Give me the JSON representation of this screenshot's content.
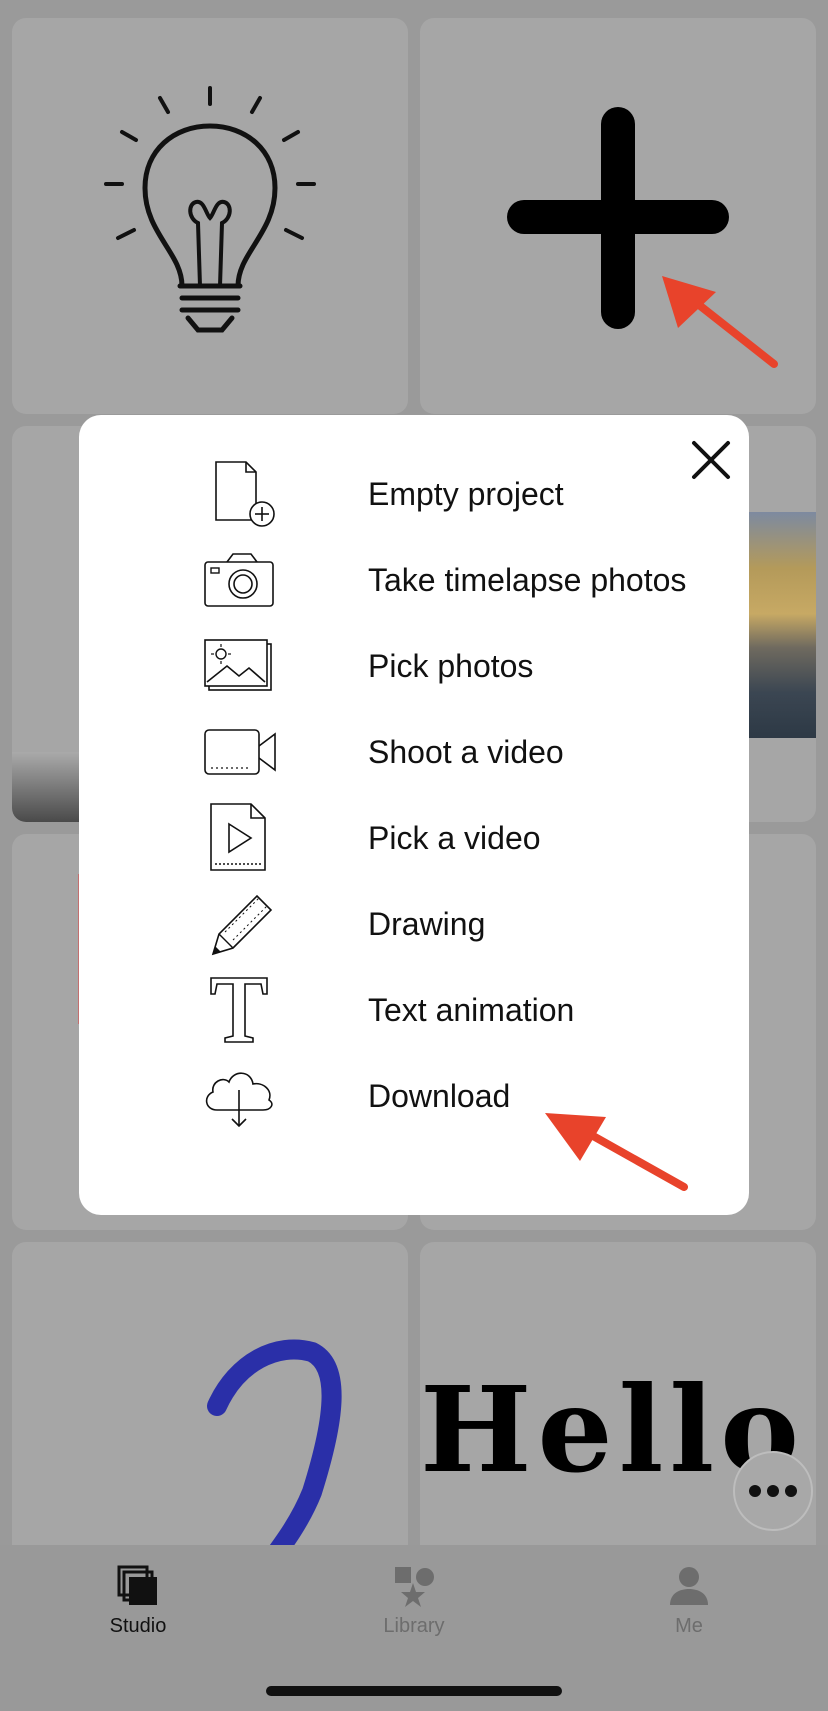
{
  "modal": {
    "items": [
      {
        "label": "Empty project",
        "icon": "new-document-icon"
      },
      {
        "label": "Take timelapse photos",
        "icon": "camera-icon"
      },
      {
        "label": "Pick photos",
        "icon": "photos-icon"
      },
      {
        "label": "Shoot a video",
        "icon": "video-camera-icon"
      },
      {
        "label": "Pick a video",
        "icon": "video-file-icon"
      },
      {
        "label": "Drawing",
        "icon": "pencil-icon"
      },
      {
        "label": "Text animation",
        "icon": "text-icon"
      },
      {
        "label": "Download",
        "icon": "cloud-download-icon"
      }
    ],
    "close_icon": "close-icon"
  },
  "grid": {
    "tiles": [
      {
        "icon": "lightbulb-icon"
      },
      {
        "icon": "plus-icon"
      },
      {
        "preview": "gradient"
      },
      {
        "preview": "photo"
      },
      {
        "preview": "blank"
      },
      {
        "preview": "blank"
      },
      {
        "preview": "drawing"
      },
      {
        "preview_text": "Hello"
      }
    ]
  },
  "tabbar": {
    "tabs": [
      {
        "label": "Studio",
        "icon": "studio-icon",
        "active": true
      },
      {
        "label": "Library",
        "icon": "library-icon",
        "active": false
      },
      {
        "label": "Me",
        "icon": "person-icon",
        "active": false
      }
    ]
  },
  "more_button": {
    "icon": "more-icon"
  },
  "annotation_color": "#e8432b"
}
